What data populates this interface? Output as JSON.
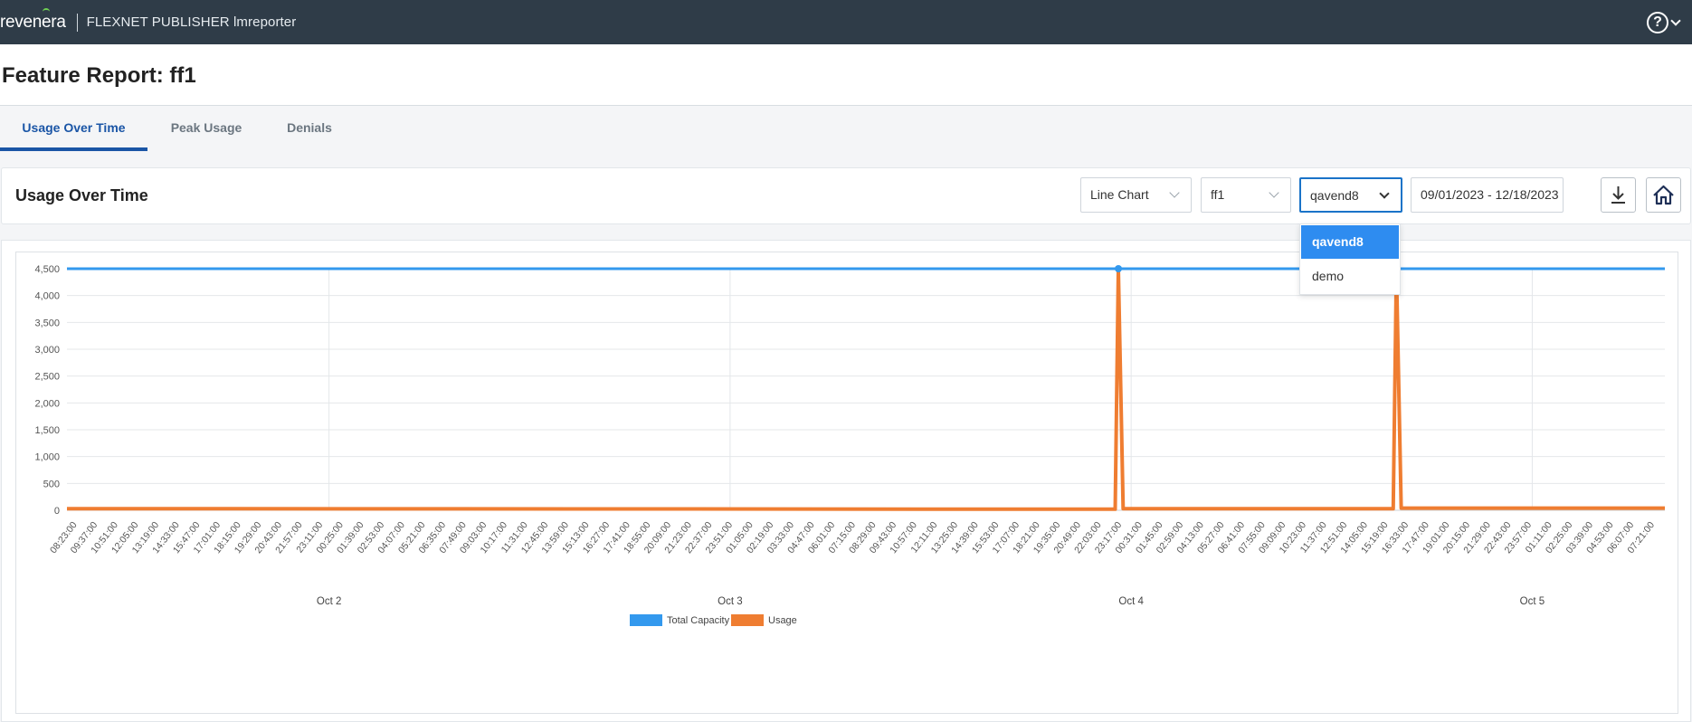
{
  "header": {
    "logo_text": "revenera",
    "product_name": "FLEXNET PUBLISHER lmreporter",
    "help_glyph": "?",
    "help_icon": "help-circle-icon",
    "help_chevron_icon": "chevron-down-icon"
  },
  "page": {
    "title": "Feature Report: ff1"
  },
  "tabs": [
    {
      "label": "Usage Over Time",
      "active": true
    },
    {
      "label": "Peak Usage",
      "active": false
    },
    {
      "label": "Denials",
      "active": false
    }
  ],
  "toolbar": {
    "title": "Usage Over Time",
    "chart_type": "Line Chart",
    "feature": "ff1",
    "vendor": "qavend8",
    "date_range": "09/01/2023 - 12/18/2023",
    "download_icon": "download-icon",
    "home_icon": "home-icon"
  },
  "vendor_dropdown": {
    "options": [
      "qavend8",
      "demo"
    ],
    "selected": "qavend8"
  },
  "colors": {
    "topbar": "#2f3c48",
    "accent": "#1a55a6",
    "total_capacity": "#3399ee",
    "usage": "#ef7d31"
  },
  "chart_data": {
    "type": "line",
    "ylim": [
      0,
      4500
    ],
    "yticks": [
      "0",
      "500",
      "1,000",
      "1,500",
      "2,000",
      "2,500",
      "3,000",
      "3,500",
      "4,000",
      "4,500"
    ],
    "xticks": [
      "08:23:00",
      "09:37:00",
      "10:51:00",
      "12:05:00",
      "13:19:00",
      "14:33:00",
      "15:47:00",
      "17:01:00",
      "18:15:00",
      "19:29:00",
      "20:43:00",
      "21:57:00",
      "23:11:00",
      "00:25:00",
      "01:39:00",
      "02:53:00",
      "04:07:00",
      "05:21:00",
      "06:35:00",
      "07:49:00",
      "09:03:00",
      "10:17:00",
      "11:31:00",
      "12:45:00",
      "13:59:00",
      "15:13:00",
      "16:27:00",
      "17:41:00",
      "18:55:00",
      "20:09:00",
      "21:23:00",
      "22:37:00",
      "23:51:00",
      "01:05:00",
      "02:19:00",
      "03:33:00",
      "04:47:00",
      "06:01:00",
      "07:15:00",
      "08:29:00",
      "09:43:00",
      "10:57:00",
      "12:11:00",
      "13:25:00",
      "14:39:00",
      "15:53:00",
      "17:07:00",
      "18:21:00",
      "19:35:00",
      "20:49:00",
      "22:03:00",
      "23:17:00",
      "00:31:00",
      "01:45:00",
      "02:59:00",
      "04:13:00",
      "05:27:00",
      "06:41:00",
      "07:55:00",
      "09:09:00",
      "10:23:00",
      "11:37:00",
      "12:51:00",
      "14:05:00",
      "15:19:00",
      "16:33:00",
      "17:47:00",
      "19:01:00",
      "20:15:00",
      "21:29:00",
      "22:43:00",
      "23:57:00",
      "01:11:00",
      "02:25:00",
      "03:39:00",
      "04:53:00",
      "06:07:00",
      "07:21:00"
    ],
    "date_labels": [
      "Oct 2",
      "Oct 3",
      "Oct 4",
      "Oct 5"
    ],
    "series": [
      {
        "name": "Total Capacity",
        "values": [
          4500,
          4500
        ]
      },
      {
        "name": "Usage",
        "values": [
          30,
          20,
          4500,
          30,
          4500,
          40
        ]
      }
    ],
    "legend_position": "bottom",
    "grid": true
  }
}
